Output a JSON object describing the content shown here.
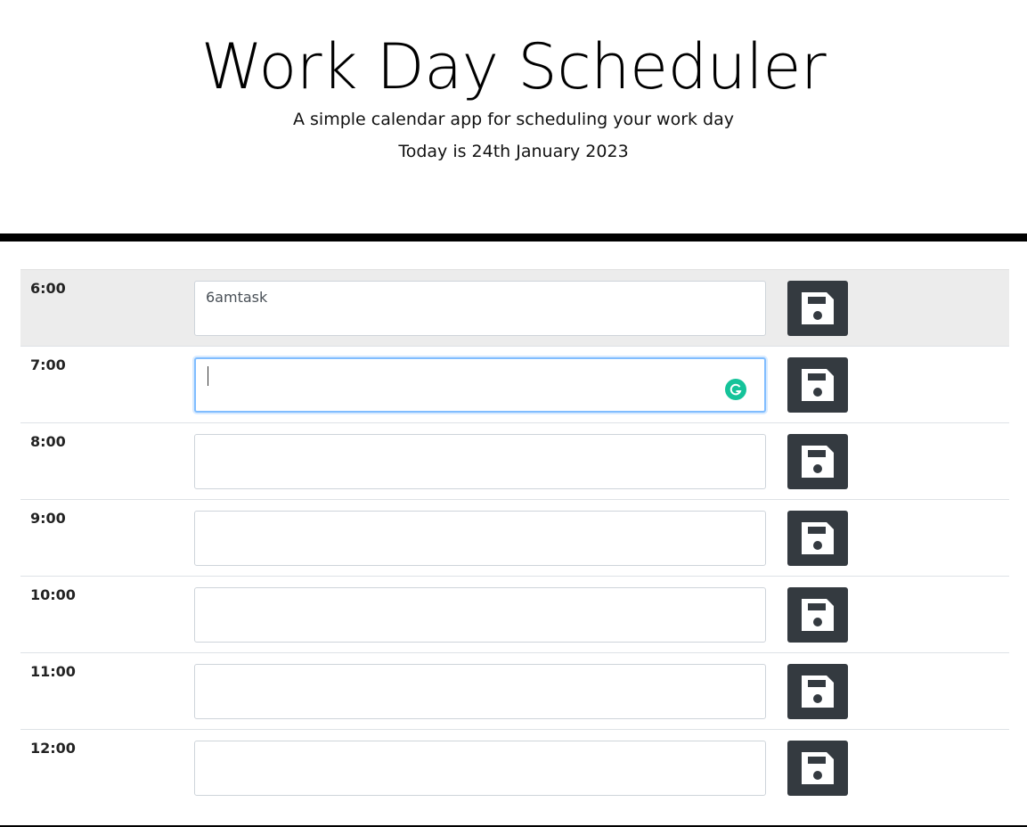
{
  "header": {
    "title": "Work Day Scheduler",
    "subtitle": "A simple calendar app for scheduling your work day",
    "current_day": "Today is 24th January 2023"
  },
  "time_blocks": [
    {
      "hour": "6:00",
      "text": "6amtask",
      "state": "past"
    },
    {
      "hour": "7:00",
      "text": "",
      "state": "focused"
    },
    {
      "hour": "8:00",
      "text": "",
      "state": "normal"
    },
    {
      "hour": "9:00",
      "text": "",
      "state": "normal"
    },
    {
      "hour": "10:00",
      "text": "",
      "state": "normal"
    },
    {
      "hour": "11:00",
      "text": "",
      "state": "normal"
    },
    {
      "hour": "12:00",
      "text": "",
      "state": "normal"
    }
  ],
  "icons": {
    "save": "floppy-disk-icon",
    "grammarly": "grammarly-icon"
  },
  "colors": {
    "save_button": "#343a40",
    "past_row": "#ececec",
    "focus_border": "#80bdff",
    "grammarly": "#15c39a"
  }
}
